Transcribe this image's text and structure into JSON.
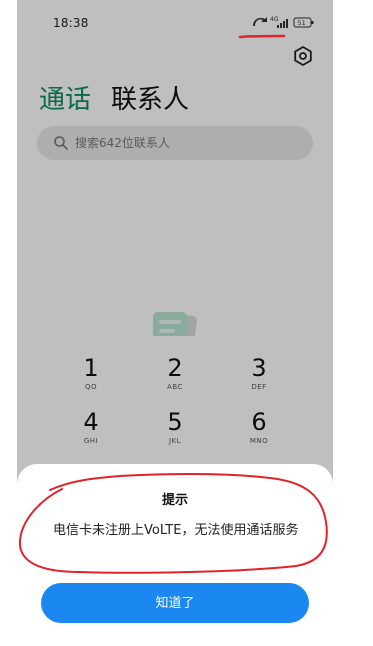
{
  "status_bar": {
    "time": "18:38",
    "network_label": "4G",
    "battery_level": "51"
  },
  "dialer": {
    "tabs": [
      {
        "label": "通话",
        "active": true
      },
      {
        "label": "联系人",
        "active": false
      }
    ],
    "search_placeholder": "搜索642位联系人",
    "keypad": [
      {
        "digit": "1",
        "letters": "QO"
      },
      {
        "digit": "2",
        "letters": "ABC"
      },
      {
        "digit": "3",
        "letters": "DEF"
      },
      {
        "digit": "4",
        "letters": "GHI"
      },
      {
        "digit": "5",
        "letters": "JKL"
      },
      {
        "digit": "6",
        "letters": "MNO"
      }
    ]
  },
  "dialog": {
    "title": "提示",
    "message": "电信卡未注册上VoLTE，无法使用通话服务",
    "confirm_label": "知道了"
  },
  "colors": {
    "accent": "#0f8c67",
    "button": "#1b87f0",
    "annotation": "#e0242b"
  },
  "icons": [
    "settings-icon",
    "search-icon",
    "signal-icon",
    "battery-icon"
  ]
}
